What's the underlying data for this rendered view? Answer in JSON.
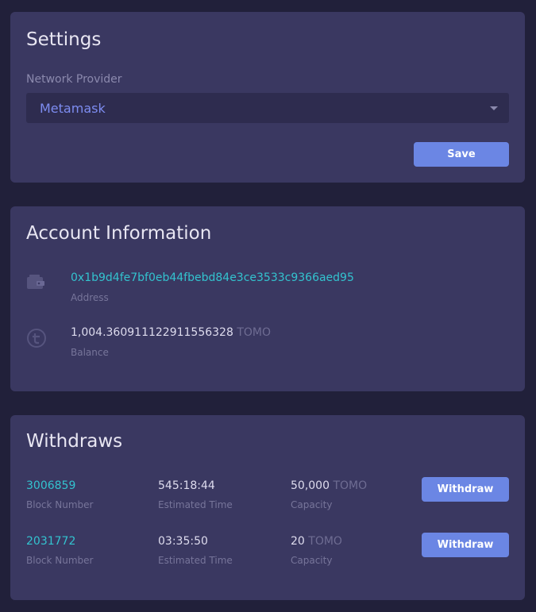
{
  "settings": {
    "title": "Settings",
    "network_label": "Network Provider",
    "network_value": "Metamask",
    "save_label": "Save"
  },
  "account": {
    "title": "Account Information",
    "address": "0x1b9d4fe7bf0eb44fbebd84e3ce3533c9366aed95",
    "address_label": "Address",
    "balance": "1,004.360911122911556328",
    "balance_unit": "TOMO",
    "balance_label": "Balance"
  },
  "withdraws": {
    "title": "Withdraws",
    "rows": [
      {
        "block_number": "3006859",
        "block_label": "Block Number",
        "time": "545:18:44",
        "time_label": "Estimated Time",
        "capacity": "50,000",
        "capacity_unit": "TOMO",
        "capacity_label": "Capacity",
        "button": "Withdraw"
      },
      {
        "block_number": "2031772",
        "block_label": "Block Number",
        "time": "03:35:50",
        "time_label": "Estimated Time",
        "capacity": "20",
        "capacity_unit": "TOMO",
        "capacity_label": "Capacity",
        "button": "Withdraw"
      }
    ]
  },
  "colors": {
    "background": "#21203a",
    "card": "#3a3861",
    "accent": "#6b86e4",
    "teal": "#33c3cf"
  },
  "icons": {
    "address_icon": "wallet-icon",
    "balance_icon": "tomo-coin-icon"
  }
}
